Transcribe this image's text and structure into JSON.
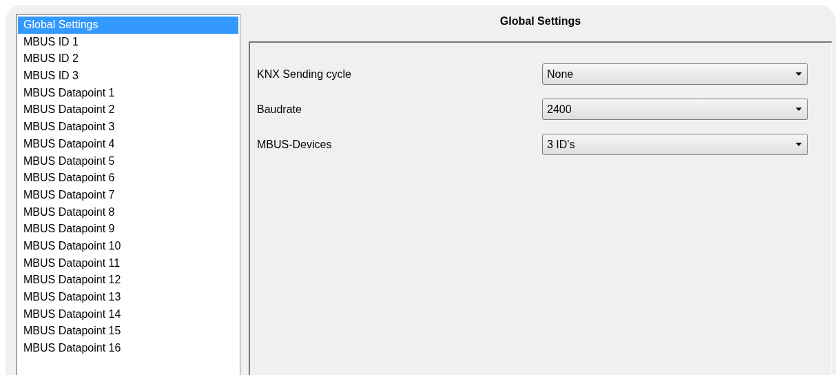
{
  "navigation": {
    "items": [
      {
        "label": "Global Settings",
        "selected": true
      },
      {
        "label": "MBUS ID 1",
        "selected": false
      },
      {
        "label": "MBUS ID 2",
        "selected": false
      },
      {
        "label": "MBUS ID 3",
        "selected": false
      },
      {
        "label": "MBUS Datapoint 1",
        "selected": false
      },
      {
        "label": "MBUS Datapoint 2",
        "selected": false
      },
      {
        "label": "MBUS Datapoint 3",
        "selected": false
      },
      {
        "label": "MBUS Datapoint 4",
        "selected": false
      },
      {
        "label": "MBUS Datapoint 5",
        "selected": false
      },
      {
        "label": "MBUS Datapoint 6",
        "selected": false
      },
      {
        "label": "MBUS Datapoint 7",
        "selected": false
      },
      {
        "label": "MBUS Datapoint 8",
        "selected": false
      },
      {
        "label": "MBUS Datapoint 9",
        "selected": false
      },
      {
        "label": "MBUS Datapoint 10",
        "selected": false
      },
      {
        "label": "MBUS Datapoint 11",
        "selected": false
      },
      {
        "label": "MBUS Datapoint 12",
        "selected": false
      },
      {
        "label": "MBUS Datapoint 13",
        "selected": false
      },
      {
        "label": "MBUS Datapoint 14",
        "selected": false
      },
      {
        "label": "MBUS Datapoint 15",
        "selected": false
      },
      {
        "label": "MBUS Datapoint 16",
        "selected": false
      }
    ]
  },
  "panel": {
    "title": "Global Settings",
    "parameters": [
      {
        "label": "KNX Sending cycle",
        "value": "None"
      },
      {
        "label": "Baudrate",
        "value": "2400"
      },
      {
        "label": "MBUS-Devices",
        "value": "3 ID's"
      }
    ]
  }
}
